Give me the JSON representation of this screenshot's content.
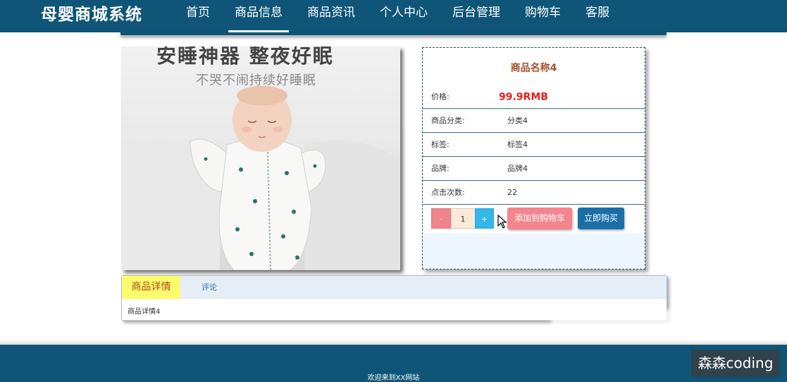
{
  "header": {
    "brand": "母婴商城系统",
    "nav": [
      "首页",
      "商品信息",
      "商品资讯",
      "个人中心",
      "后台管理",
      "购物车",
      "客服"
    ],
    "active_nav": "商品信息"
  },
  "product": {
    "image_headline": "安睡神器 整夜好眠",
    "image_subline": "不哭不闹持续好睡眠",
    "name": "商品名称4",
    "price_label": "价格:",
    "price_value": "99.9RMB",
    "category_label": "商品分类:",
    "category_value": "分类4",
    "tag_label": "标签:",
    "tag_value": "标签4",
    "brand_label": "品牌:",
    "brand_value": "品牌4",
    "clicks_label": "点击次数:",
    "clicks_value": "22"
  },
  "quantity": {
    "minus": "-",
    "value": "1",
    "plus": "+"
  },
  "actions": {
    "add_to_cart": "添加到购物车",
    "buy_now": "立即购买"
  },
  "tabs": {
    "detail_label": "商品详情",
    "comment_label": "评论",
    "detail_text": "商品详情4"
  },
  "footer": {
    "text": "欢迎来到XX网站"
  },
  "watermark": "森森coding",
  "colors": {
    "header_bg": "#0e5577",
    "price": "#e41e1e",
    "product_name": "#a0522d",
    "add_to_cart_bg": "#f4858c",
    "buy_now_bg": "#1b6fa7",
    "active_tab_bg": "#fbfb6c"
  }
}
